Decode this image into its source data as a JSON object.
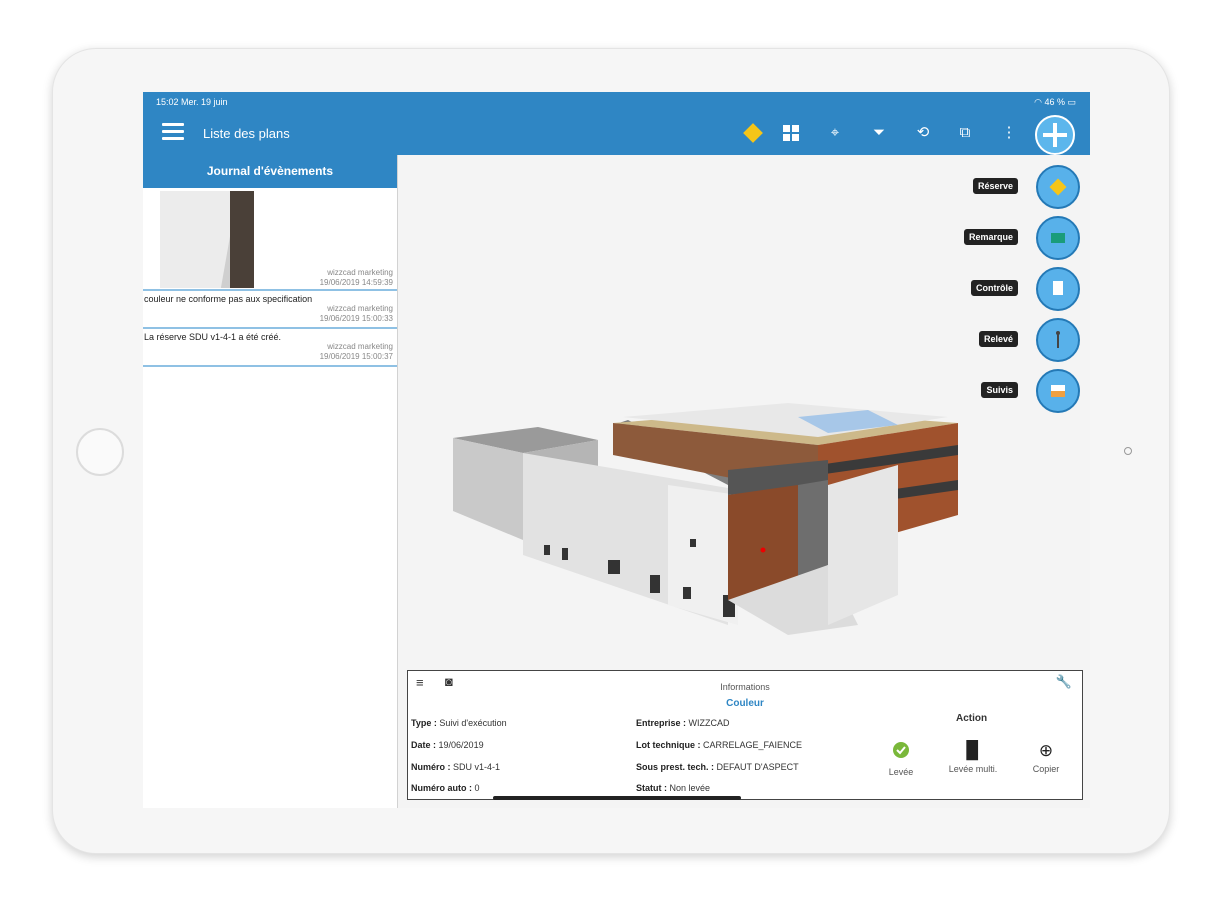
{
  "status_bar": {
    "time": "15:02  Mer. 19 juin",
    "battery": "46 %"
  },
  "header": {
    "title": "Liste des plans"
  },
  "toolbar": {
    "icons": [
      "reserve-marker",
      "grid",
      "target",
      "filter",
      "sync",
      "layers",
      "more"
    ]
  },
  "sidebar": {
    "title": "Journal d'évènements",
    "events": [
      {
        "text": "",
        "author": "wizzcad marketing",
        "date": "19/06/2019 14:59:39"
      },
      {
        "text": "couleur ne conforme pas aux specification",
        "author": "wizzcad marketing",
        "date": "19/06/2019 15:00:33"
      },
      {
        "text": "La réserve SDU v1-4-1 a été créé.",
        "author": "wizzcad marketing",
        "date": "19/06/2019 15:00:37"
      }
    ]
  },
  "fab_menu": [
    "Réserve",
    "Remarque",
    "Contrôle",
    "Relevé",
    "Suivis"
  ],
  "info": {
    "title": "Informations",
    "subtitle": "Couleur",
    "type_label": "Type :",
    "type_value": "Suivi d'exécution",
    "date_label": "Date :",
    "date_value": "19/06/2019",
    "numero_label": "Numéro :",
    "numero_value": "SDU v1-4-1",
    "numero_auto_label": "Numéro auto :",
    "numero_auto_value": "0",
    "entreprise_label": "Entreprise :",
    "entreprise_value": "WIZZCAD",
    "lot_label": "Lot technique :",
    "lot_value": "CARRELAGE_FAIENCE",
    "sous_label": "Sous prest. tech. :",
    "sous_value": "DEFAUT D'ASPECT",
    "statut_label": "Statut :",
    "statut_value": "Non levée",
    "action_title": "Action",
    "actions": [
      "Levée",
      "Levée multi.",
      "Copier"
    ]
  },
  "colors": {
    "accent": "#2f86c4",
    "fab": "#58b1ea",
    "link": "#2f86c4",
    "success": "#7ab83a"
  }
}
